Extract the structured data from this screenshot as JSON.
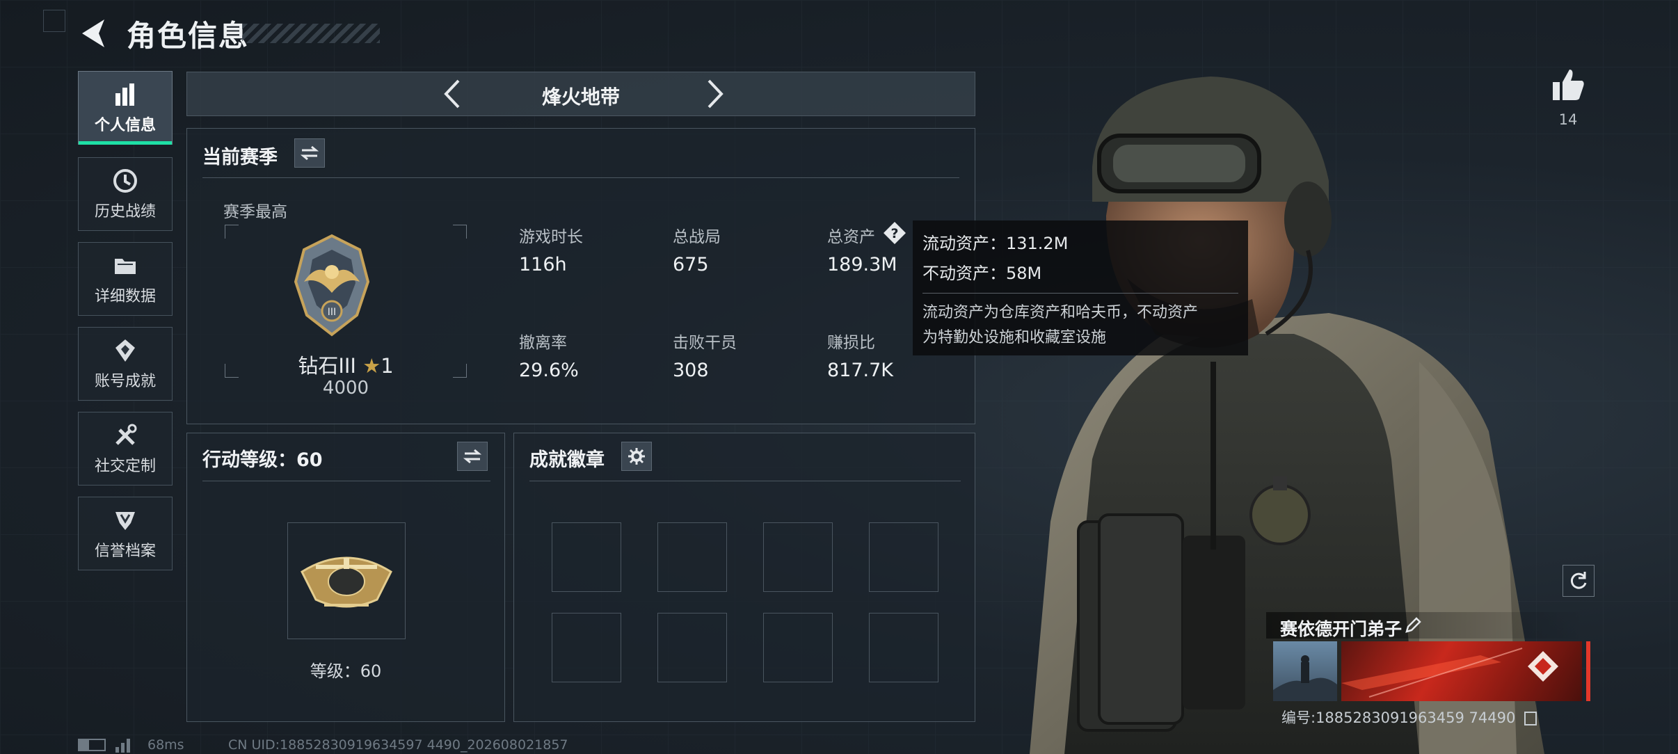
{
  "header": {
    "title": "角色信息"
  },
  "sidebar": {
    "items": [
      {
        "label": "个人信息",
        "icon": "bar-chart-icon",
        "active": true
      },
      {
        "label": "历史战绩",
        "icon": "history-icon"
      },
      {
        "label": "详细数据",
        "icon": "folder-icon"
      },
      {
        "label": "账号成就",
        "icon": "achievement-icon"
      },
      {
        "label": "社交定制",
        "icon": "tools-icon"
      },
      {
        "label": "信誉档案",
        "icon": "reputation-icon"
      }
    ]
  },
  "mode": {
    "name": "烽火地带"
  },
  "season": {
    "title": "当前赛季",
    "best_label": "赛季最高",
    "rank_name": "钻石III",
    "rank_stars": "1",
    "rank_score": "4000",
    "stats": [
      {
        "label": "游戏时长",
        "value": "116h"
      },
      {
        "label": "总战局",
        "value": "675"
      },
      {
        "label": "总资产",
        "value": "189.3M"
      },
      {
        "label": "撤离率",
        "value": "29.6%"
      },
      {
        "label": "击败干员",
        "value": "308"
      },
      {
        "label": "赚损比",
        "value": "817.7K"
      }
    ]
  },
  "tooltip": {
    "liquid": "流动资产：131.2M",
    "fixed": "不动资产：58M",
    "desc_line1": "流动资产为仓库资产和哈夫币，不动资产",
    "desc_line2": "为特勤处设施和收藏室设施"
  },
  "action_level": {
    "title": "行动等级：60",
    "level_text": "等级：60"
  },
  "badges": {
    "title": "成就徽章"
  },
  "profile": {
    "likes": "14",
    "nickname": "赛依德开门弟子",
    "id_text": "编号:1885283091963459 74490"
  },
  "footer": {
    "ping": "68ms",
    "uid": "CN UID:18852830919634597 4490_202608021857"
  },
  "colors": {
    "accent": "#1fe0a6",
    "card_red": "#c8281c"
  }
}
